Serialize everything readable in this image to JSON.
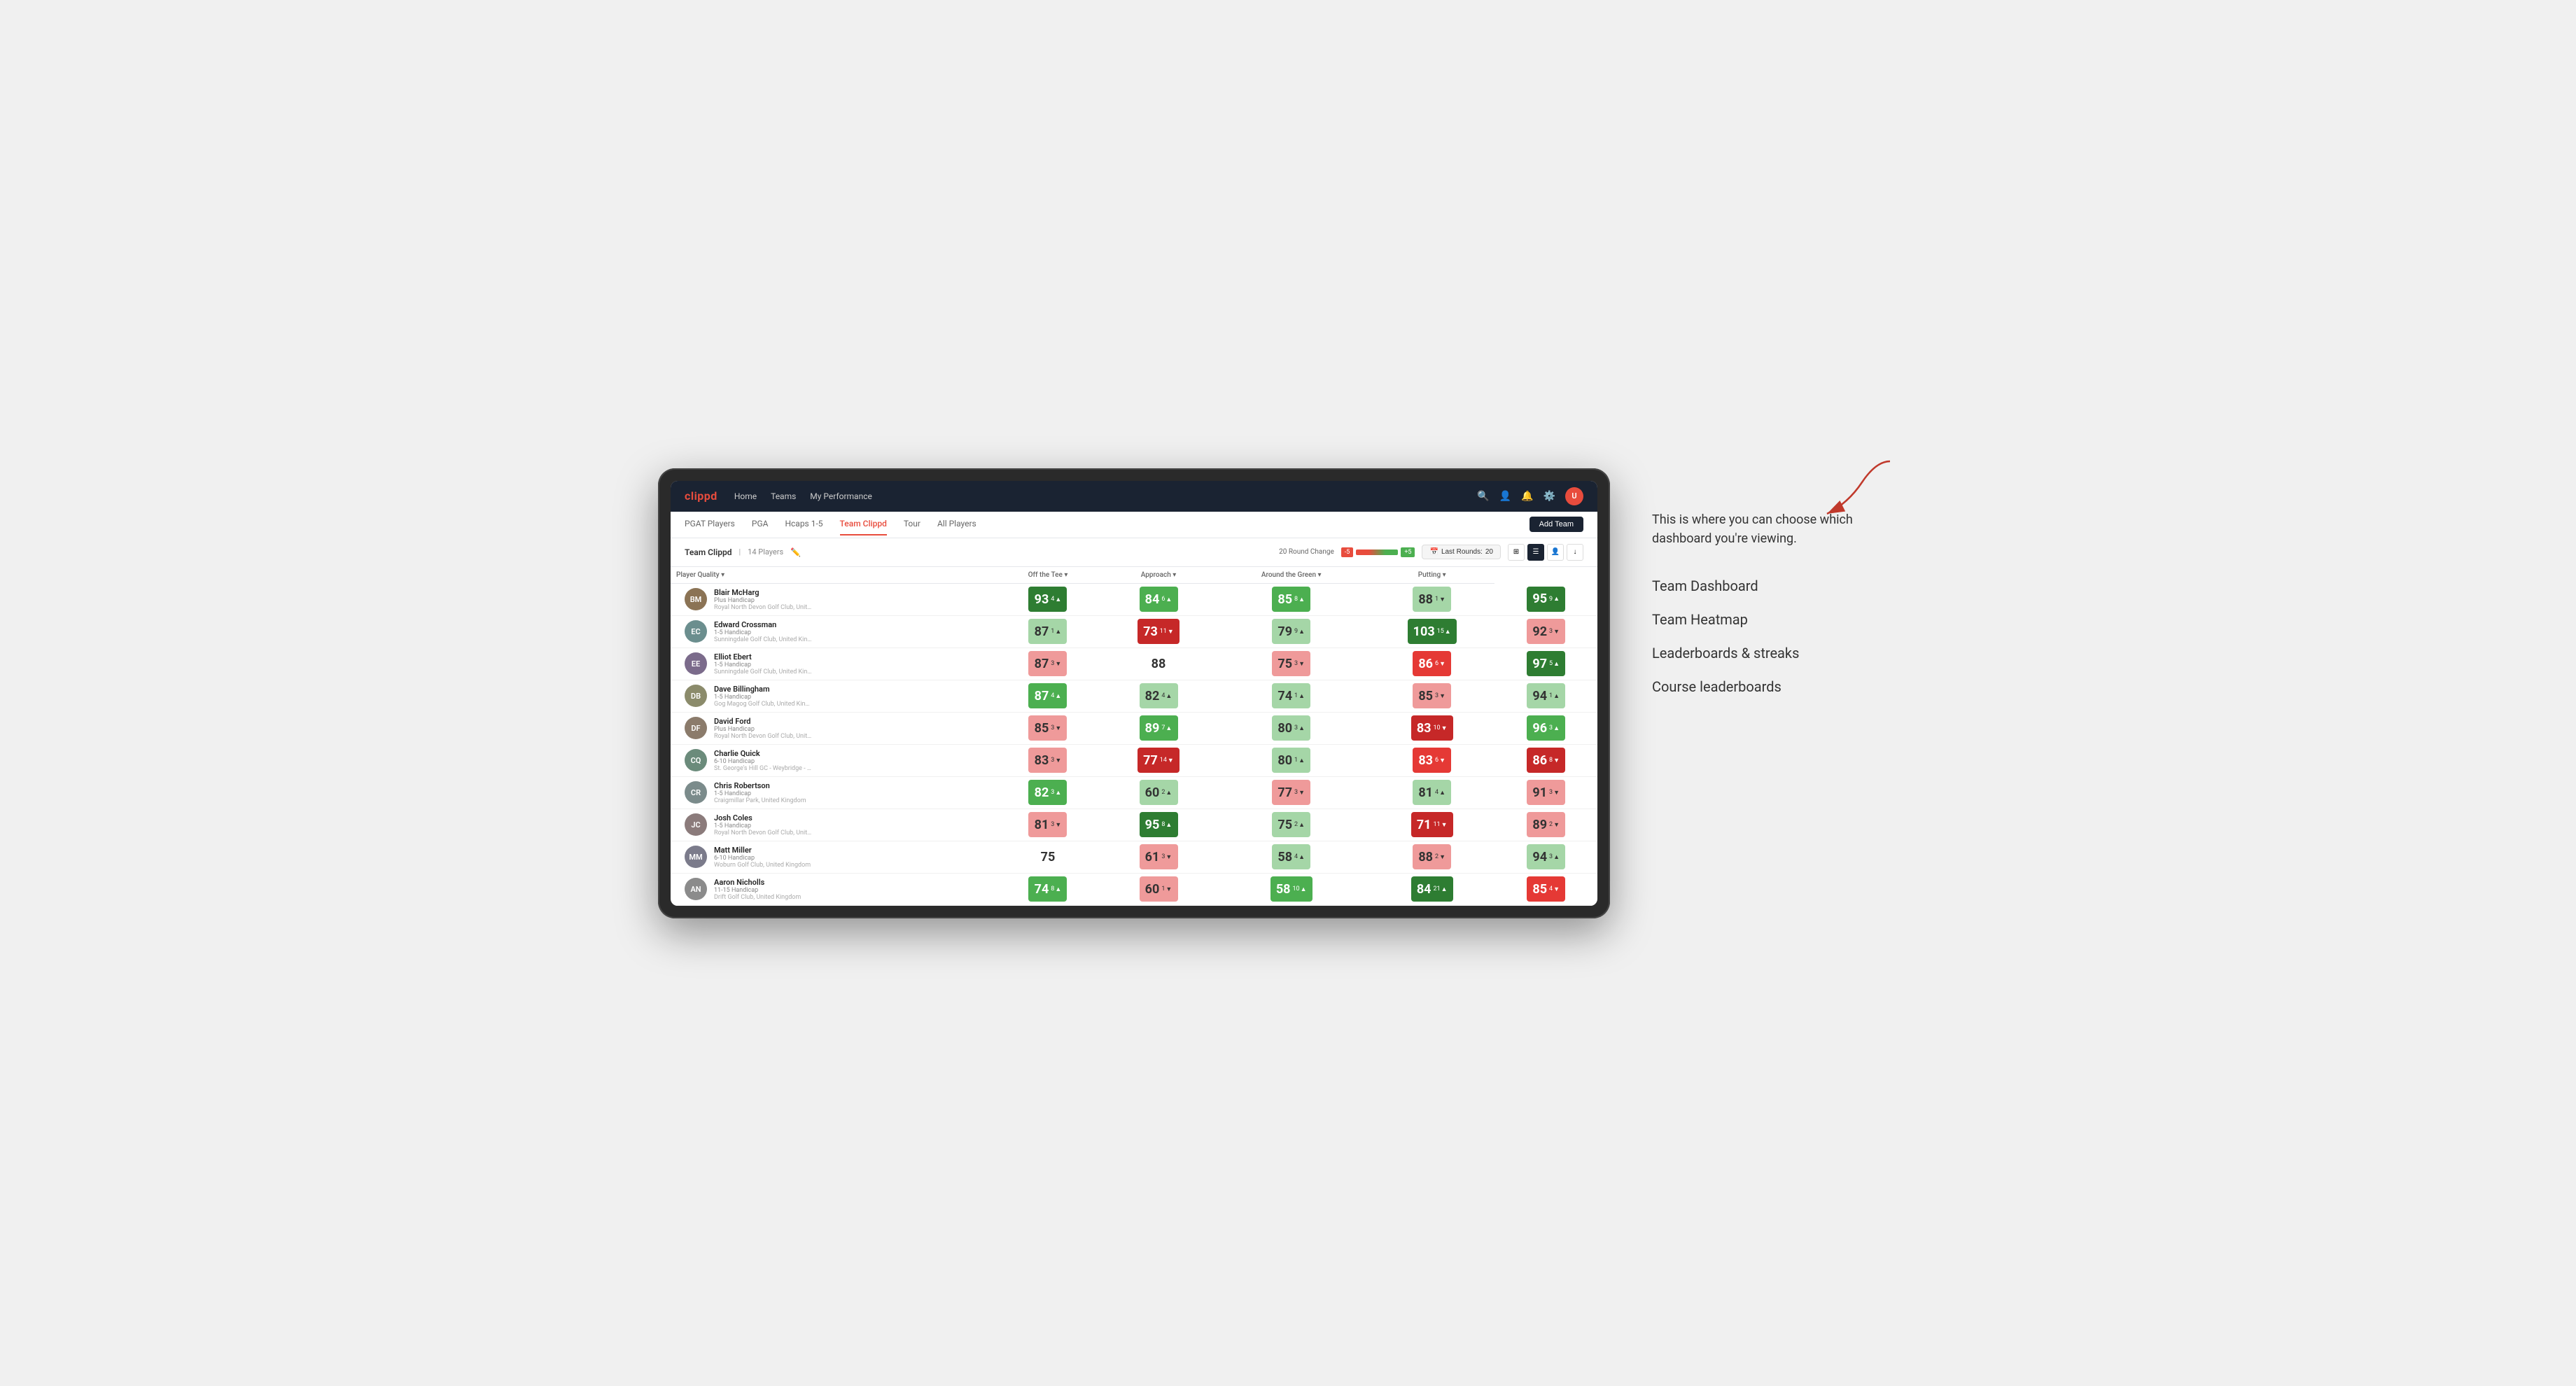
{
  "annotation": {
    "description": "This is where you can choose which dashboard you're viewing.",
    "arrow_target": "dashboard-selector",
    "options": [
      "Team Dashboard",
      "Team Heatmap",
      "Leaderboards & streaks",
      "Course leaderboards"
    ]
  },
  "app": {
    "logo": "clippd",
    "nav": [
      "Home",
      "Teams",
      "My Performance"
    ],
    "sub_nav": [
      "PGAT Players",
      "PGA",
      "Hcaps 1-5",
      "Team Clippd",
      "Tour",
      "All Players"
    ],
    "active_sub_nav": "Team Clippd",
    "add_team_label": "Add Team"
  },
  "team": {
    "name": "Team Clippd",
    "player_count": "14 Players",
    "round_change_label": "20 Round Change",
    "neg_change": "-5",
    "pos_change": "+5",
    "last_rounds_label": "Last Rounds:",
    "last_rounds_value": "20"
  },
  "columns": {
    "player": "Player Quality",
    "off_tee": "Off the Tee",
    "approach": "Approach",
    "around_green": "Around the Green",
    "putting": "Putting"
  },
  "players": [
    {
      "name": "Blair McHarg",
      "handicap": "Plus Handicap",
      "club": "Royal North Devon Golf Club, United Kingdom",
      "initials": "BM",
      "avatar_color": "#8B7355",
      "scores": {
        "player_quality": {
          "value": 93,
          "change": 4,
          "dir": "up",
          "color": "green-dark"
        },
        "off_tee": {
          "value": 84,
          "change": 6,
          "dir": "up",
          "color": "green-med"
        },
        "approach": {
          "value": 85,
          "change": 8,
          "dir": "up",
          "color": "green-med"
        },
        "around_green": {
          "value": 88,
          "change": 1,
          "dir": "down",
          "color": "green-light"
        },
        "putting": {
          "value": 95,
          "change": 9,
          "dir": "up",
          "color": "green-dark"
        }
      }
    },
    {
      "name": "Edward Crossman",
      "handicap": "1-5 Handicap",
      "club": "Sunningdale Golf Club, United Kingdom",
      "initials": "EC",
      "avatar_color": "#6B8E8E",
      "scores": {
        "player_quality": {
          "value": 87,
          "change": 1,
          "dir": "up",
          "color": "green-light"
        },
        "off_tee": {
          "value": 73,
          "change": 11,
          "dir": "down",
          "color": "red-dark"
        },
        "approach": {
          "value": 79,
          "change": 9,
          "dir": "up",
          "color": "green-light"
        },
        "around_green": {
          "value": 103,
          "change": 15,
          "dir": "up",
          "color": "green-dark"
        },
        "putting": {
          "value": 92,
          "change": 3,
          "dir": "down",
          "color": "red-light"
        }
      }
    },
    {
      "name": "Elliot Ebert",
      "handicap": "1-5 Handicap",
      "club": "Sunningdale Golf Club, United Kingdom",
      "initials": "EE",
      "avatar_color": "#7B6B8B",
      "scores": {
        "player_quality": {
          "value": 87,
          "change": 3,
          "dir": "down",
          "color": "red-light"
        },
        "off_tee": {
          "value": 88,
          "change": 0,
          "dir": "",
          "color": "white-bg"
        },
        "approach": {
          "value": 75,
          "change": 3,
          "dir": "down",
          "color": "red-light"
        },
        "around_green": {
          "value": 86,
          "change": 6,
          "dir": "down",
          "color": "red-med"
        },
        "putting": {
          "value": 97,
          "change": 5,
          "dir": "up",
          "color": "green-dark"
        }
      }
    },
    {
      "name": "Dave Billingham",
      "handicap": "1-5 Handicap",
      "club": "Gog Magog Golf Club, United Kingdom",
      "initials": "DB",
      "avatar_color": "#8B8B6B",
      "scores": {
        "player_quality": {
          "value": 87,
          "change": 4,
          "dir": "up",
          "color": "green-med"
        },
        "off_tee": {
          "value": 82,
          "change": 4,
          "dir": "up",
          "color": "green-light"
        },
        "approach": {
          "value": 74,
          "change": 1,
          "dir": "up",
          "color": "green-light"
        },
        "around_green": {
          "value": 85,
          "change": 3,
          "dir": "down",
          "color": "red-light"
        },
        "putting": {
          "value": 94,
          "change": 1,
          "dir": "up",
          "color": "green-light"
        }
      }
    },
    {
      "name": "David Ford",
      "handicap": "Plus Handicap",
      "club": "Royal North Devon Golf Club, United Kingdom",
      "initials": "DF",
      "avatar_color": "#8B7B6B",
      "scores": {
        "player_quality": {
          "value": 85,
          "change": 3,
          "dir": "down",
          "color": "red-light"
        },
        "off_tee": {
          "value": 89,
          "change": 7,
          "dir": "up",
          "color": "green-med"
        },
        "approach": {
          "value": 80,
          "change": 3,
          "dir": "up",
          "color": "green-light"
        },
        "around_green": {
          "value": 83,
          "change": 10,
          "dir": "down",
          "color": "red-dark"
        },
        "putting": {
          "value": 96,
          "change": 3,
          "dir": "up",
          "color": "green-med"
        }
      }
    },
    {
      "name": "Charlie Quick",
      "handicap": "6-10 Handicap",
      "club": "St. George's Hill GC - Weybridge - Surrey, Uni...",
      "initials": "CQ",
      "avatar_color": "#6B8B7B",
      "scores": {
        "player_quality": {
          "value": 83,
          "change": 3,
          "dir": "down",
          "color": "red-light"
        },
        "off_tee": {
          "value": 77,
          "change": 14,
          "dir": "down",
          "color": "red-dark"
        },
        "approach": {
          "value": 80,
          "change": 1,
          "dir": "up",
          "color": "green-light"
        },
        "around_green": {
          "value": 83,
          "change": 6,
          "dir": "down",
          "color": "red-med"
        },
        "putting": {
          "value": 86,
          "change": 8,
          "dir": "down",
          "color": "red-dark"
        }
      }
    },
    {
      "name": "Chris Robertson",
      "handicap": "1-5 Handicap",
      "club": "Craigmillar Park, United Kingdom",
      "initials": "CR",
      "avatar_color": "#7B8B8B",
      "scores": {
        "player_quality": {
          "value": 82,
          "change": 3,
          "dir": "up",
          "color": "green-med"
        },
        "off_tee": {
          "value": 60,
          "change": 2,
          "dir": "up",
          "color": "green-light"
        },
        "approach": {
          "value": 77,
          "change": 3,
          "dir": "down",
          "color": "red-light"
        },
        "around_green": {
          "value": 81,
          "change": 4,
          "dir": "up",
          "color": "green-light"
        },
        "putting": {
          "value": 91,
          "change": 3,
          "dir": "down",
          "color": "red-light"
        }
      }
    },
    {
      "name": "Josh Coles",
      "handicap": "1-5 Handicap",
      "club": "Royal North Devon Golf Club, United Kingdom",
      "initials": "JC",
      "avatar_color": "#8B7B7B",
      "scores": {
        "player_quality": {
          "value": 81,
          "change": 3,
          "dir": "down",
          "color": "red-light"
        },
        "off_tee": {
          "value": 95,
          "change": 8,
          "dir": "up",
          "color": "green-dark"
        },
        "approach": {
          "value": 75,
          "change": 2,
          "dir": "up",
          "color": "green-light"
        },
        "around_green": {
          "value": 71,
          "change": 11,
          "dir": "down",
          "color": "red-dark"
        },
        "putting": {
          "value": 89,
          "change": 2,
          "dir": "down",
          "color": "red-light"
        }
      }
    },
    {
      "name": "Matt Miller",
      "handicap": "6-10 Handicap",
      "club": "Woburn Golf Club, United Kingdom",
      "initials": "MM",
      "avatar_color": "#7B7B8B",
      "scores": {
        "player_quality": {
          "value": 75,
          "change": 0,
          "dir": "",
          "color": "white-bg"
        },
        "off_tee": {
          "value": 61,
          "change": 3,
          "dir": "down",
          "color": "red-light"
        },
        "approach": {
          "value": 58,
          "change": 4,
          "dir": "up",
          "color": "green-light"
        },
        "around_green": {
          "value": 88,
          "change": 2,
          "dir": "down",
          "color": "red-light"
        },
        "putting": {
          "value": 94,
          "change": 3,
          "dir": "up",
          "color": "green-light"
        }
      }
    },
    {
      "name": "Aaron Nicholls",
      "handicap": "11-15 Handicap",
      "club": "Drift Golf Club, United Kingdom",
      "initials": "AN",
      "avatar_color": "#8B8B8B",
      "scores": {
        "player_quality": {
          "value": 74,
          "change": 8,
          "dir": "up",
          "color": "green-med"
        },
        "off_tee": {
          "value": 60,
          "change": 1,
          "dir": "down",
          "color": "red-light"
        },
        "approach": {
          "value": 58,
          "change": 10,
          "dir": "up",
          "color": "green-med"
        },
        "around_green": {
          "value": 84,
          "change": 21,
          "dir": "up",
          "color": "green-dark"
        },
        "putting": {
          "value": 85,
          "change": 4,
          "dir": "down",
          "color": "red-med"
        }
      }
    }
  ]
}
